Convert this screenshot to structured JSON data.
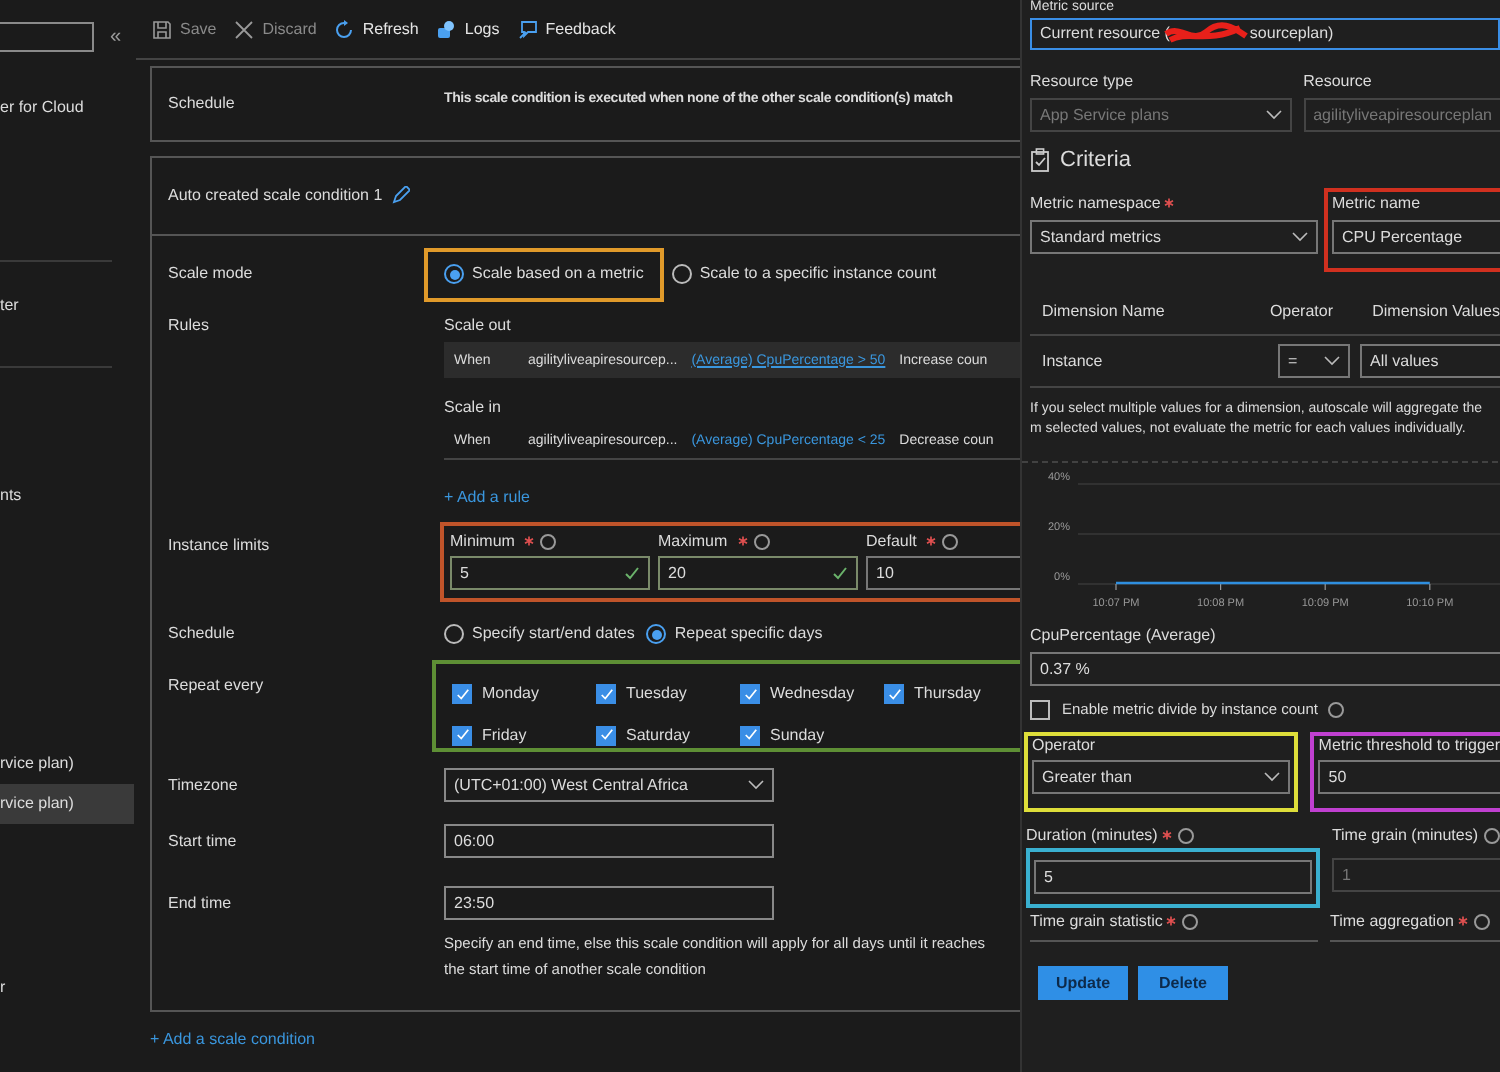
{
  "sidebar": {
    "collapse_glyph": "«",
    "items": [
      {
        "label": "er for Cloud",
        "selected": false
      },
      {
        "label": "ter",
        "selected": false
      },
      {
        "label": "nts",
        "selected": false
      },
      {
        "label": "rvice plan)",
        "selected": false
      },
      {
        "label": "rvice plan)",
        "selected": true
      },
      {
        "label": "r",
        "selected": false
      }
    ]
  },
  "toolbar": [
    {
      "kind": "save",
      "label": "Save",
      "disabled": true
    },
    {
      "kind": "discard",
      "label": "Discard",
      "disabled": true
    },
    {
      "kind": "refresh",
      "label": "Refresh",
      "disabled": false
    },
    {
      "kind": "logs",
      "label": "Logs",
      "disabled": false
    },
    {
      "kind": "feedback",
      "label": "Feedback",
      "disabled": false
    }
  ],
  "default_condition": {
    "label": "Schedule",
    "text": "This scale condition is executed when none of the other scale condition(s) match"
  },
  "condition": {
    "title": "Auto created scale condition 1",
    "scale_mode": {
      "label": "Scale mode",
      "options": [
        {
          "label": "Scale based on a metric",
          "selected": true
        },
        {
          "label": "Scale to a specific instance count",
          "selected": false
        }
      ]
    },
    "rules": {
      "label": "Rules",
      "groups": [
        {
          "title": "Scale out",
          "when": "When",
          "resource": "agilityliveapiresourcep...",
          "metric": "(Average) CpuPercentage > 50",
          "action": "Increase coun",
          "highlighted": true
        },
        {
          "title": "Scale in",
          "when": "When",
          "resource": "agilityliveapiresourcep...",
          "metric": "(Average) CpuPercentage < 25",
          "action": "Decrease coun",
          "highlighted": false
        }
      ],
      "add_rule": "+ Add a rule"
    },
    "instance_limits": {
      "label": "Instance limits",
      "fields": [
        {
          "label": "Minimum",
          "required": true,
          "value": "5",
          "valid": true
        },
        {
          "label": "Maximum",
          "required": true,
          "value": "20",
          "valid": true
        },
        {
          "label": "Default",
          "required": true,
          "value": "10",
          "valid": false
        }
      ]
    },
    "schedule": {
      "label": "Schedule",
      "options": [
        {
          "label": "Specify start/end dates",
          "selected": false
        },
        {
          "label": "Repeat specific days",
          "selected": true
        }
      ]
    },
    "repeat": {
      "label": "Repeat every",
      "days": [
        {
          "label": "Monday",
          "checked": true
        },
        {
          "label": "Tuesday",
          "checked": true
        },
        {
          "label": "Wednesday",
          "checked": true
        },
        {
          "label": "Thursday",
          "checked": true
        },
        {
          "label": "Friday",
          "checked": true
        },
        {
          "label": "Saturday",
          "checked": true
        },
        {
          "label": "Sunday",
          "checked": true
        }
      ]
    },
    "timezone": {
      "label": "Timezone",
      "value": "(UTC+01:00) West Central Africa"
    },
    "start_time": {
      "label": "Start time",
      "value": "06:00"
    },
    "end_time": {
      "label": "End time",
      "value": "23:50",
      "help": "Specify an end time, else this scale condition will apply for all days until it reaches the start time of another scale condition"
    }
  },
  "add_condition": "+ Add a scale condition",
  "rule_panel": {
    "metric_source": {
      "label": "Metric source",
      "value_start": "Current resource (",
      "value_end": "sourceplan)"
    },
    "resource_type": {
      "label": "Resource type",
      "value": "App Service plans",
      "disabled": true
    },
    "resource": {
      "label": "Resource",
      "value": "agilityliveapiresourceplan",
      "disabled": true
    },
    "criteria": "Criteria",
    "metric_namespace": {
      "label": "Metric namespace",
      "required": true,
      "value": "Standard metrics"
    },
    "metric_name": {
      "label": "Metric name",
      "value": "CPU Percentage"
    },
    "dimensions": {
      "columns": [
        "Dimension Name",
        "Operator",
        "Dimension Values"
      ],
      "rows": [
        {
          "name": "Instance",
          "operator": "=",
          "values": "All values"
        }
      ]
    },
    "dimension_help": "If you select multiple values for a dimension, autoscale will aggregate the m selected values, not evaluate the metric for each values individually.",
    "chart": {
      "chart_data": {
        "type": "line",
        "categories": [
          "10:07 PM",
          "10:08 PM",
          "10:09 PM",
          "10:10 PM"
        ],
        "series": [
          {
            "color": "#2f8fdf",
            "values": [
              0.4,
              0.4,
              0.4,
              0.4
            ]
          }
        ],
        "ylim": [
          0,
          40
        ],
        "yticks": [
          {
            "value": 0,
            "label": "0%"
          },
          {
            "value": 20,
            "label": "20%"
          },
          {
            "value": 40,
            "label": "40%"
          }
        ]
      }
    },
    "current_value": {
      "label": "CpuPercentage (Average)",
      "value": "0.37 %"
    },
    "divide_by_instance": {
      "label": "Enable metric divide by instance count",
      "checked": false
    },
    "operator": {
      "label": "Operator",
      "value": "Greater than"
    },
    "threshold": {
      "label": "Metric threshold to trigger",
      "value": "50"
    },
    "duration": {
      "label": "Duration (minutes)",
      "required": true,
      "value": "5"
    },
    "time_grain": {
      "label": "Time grain (minutes)",
      "value": "1",
      "disabled": true
    },
    "time_grain_statistic": {
      "label": "Time grain statistic",
      "required": true
    },
    "time_aggregation": {
      "label": "Time aggregation",
      "required": true
    },
    "buttons": [
      "Update",
      "Delete"
    ]
  }
}
